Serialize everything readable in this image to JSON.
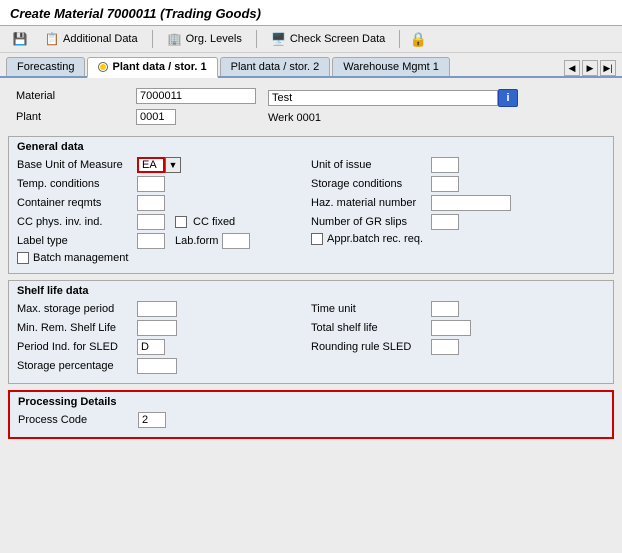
{
  "title": "Create Material 7000011 (Trading Goods)",
  "toolbar": {
    "btn_additional_data": "Additional Data",
    "btn_org_levels": "Org. Levels",
    "btn_check_screen": "Check Screen Data"
  },
  "tabs": [
    {
      "id": "forecasting",
      "label": "Forecasting",
      "active": false
    },
    {
      "id": "plant-data-1",
      "label": "Plant data / stor. 1",
      "active": true,
      "has_radio": true
    },
    {
      "id": "plant-data-2",
      "label": "Plant data / stor. 2",
      "active": false
    },
    {
      "id": "warehouse-mgmt",
      "label": "Warehouse Mgmt 1",
      "active": false
    }
  ],
  "material": {
    "label": "Material",
    "value": "7000011",
    "description": "Test",
    "plant_label": "Plant",
    "plant_value": "0001",
    "plant_desc": "Werk 0001"
  },
  "general_data": {
    "title": "General data",
    "base_uom_label": "Base Unit of Measure",
    "base_uom_value": "EA",
    "unit_of_issue_label": "Unit of issue",
    "unit_of_issue_value": "",
    "temp_conditions_label": "Temp. conditions",
    "temp_conditions_value": "",
    "storage_conditions_label": "Storage conditions",
    "storage_conditions_value": "",
    "container_reqmts_label": "Container reqmts",
    "container_reqmts_value": "",
    "haz_material_label": "Haz. material number",
    "haz_material_value": "",
    "cc_phys_label": "CC phys. inv. ind.",
    "cc_phys_value": "",
    "cc_fixed_label": "CC fixed",
    "cc_fixed_checked": false,
    "gr_slips_label": "Number of GR slips",
    "gr_slips_value": "",
    "label_type_label": "Label type",
    "label_type_value": "",
    "lab_form_label": "Lab.form",
    "lab_form_value": "",
    "appr_batch_label": "Appr.batch rec. req.",
    "appr_batch_checked": false,
    "batch_mgmt_label": "Batch management",
    "batch_mgmt_checked": false
  },
  "shelf_life": {
    "title": "Shelf life data",
    "max_storage_label": "Max. storage period",
    "max_storage_value": "",
    "time_unit_label": "Time unit",
    "time_unit_value": "",
    "min_rem_label": "Min. Rem. Shelf Life",
    "min_rem_value": "",
    "total_shelf_label": "Total shelf life",
    "total_shelf_value": "",
    "period_ind_label": "Period Ind. for SLED",
    "period_ind_value": "D",
    "rounding_rule_label": "Rounding rule SLED",
    "rounding_rule_value": "",
    "storage_pct_label": "Storage percentage",
    "storage_pct_value": ""
  },
  "processing": {
    "title": "Processing Details",
    "process_code_label": "Process Code",
    "process_code_value": "2"
  }
}
